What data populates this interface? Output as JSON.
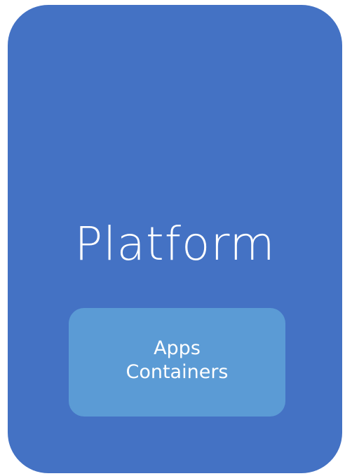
{
  "diagram": {
    "platform": {
      "label": "Platform",
      "color": "#4472c4"
    },
    "inner": {
      "line1": "Apps",
      "line2": "Containers",
      "color": "#5b9bd5"
    }
  }
}
